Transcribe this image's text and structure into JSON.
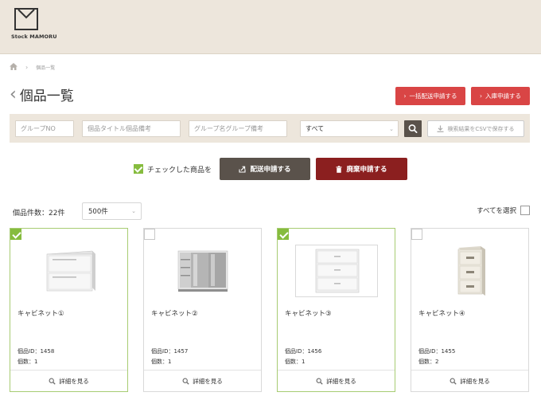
{
  "header": {
    "logo_text": "Stock MAMORU"
  },
  "breadcrumb": {
    "current": "個品一覧"
  },
  "page": {
    "title": "個品一覧"
  },
  "top_buttons": {
    "bulk_ship": "一括配送申請する",
    "warehouse": "入庫申請する"
  },
  "filter": {
    "group_no_placeholder": "グループNO",
    "title_placeholder": "個品タイトル個品備考",
    "group_name_placeholder": "グループ名グループ備考",
    "select_value": "すべて",
    "csv_label": "検索結果をCSVで保存する"
  },
  "actions": {
    "checked_label": "チェックした商品を",
    "ship_label": "配送申請する",
    "dispose_label": "廃棄申請する"
  },
  "list": {
    "count_label": "個品件数：22件",
    "per_page": "500件",
    "select_all": "すべてを選択"
  },
  "items": [
    {
      "name": "キャビネット①",
      "id_label": "個品ID：1458",
      "qty_label": "個数：1",
      "detail_label": "詳細を見る",
      "checked": true
    },
    {
      "name": "キャビネット②",
      "id_label": "個品ID：1457",
      "qty_label": "個数：1",
      "detail_label": "詳細を見る",
      "checked": false
    },
    {
      "name": "キャビネット③",
      "id_label": "個品ID：1456",
      "qty_label": "個数：1",
      "detail_label": "詳細を見る",
      "checked": true
    },
    {
      "name": "キャビネット④",
      "id_label": "個品ID：1455",
      "qty_label": "個数：2",
      "detail_label": "詳細を見る",
      "checked": false
    }
  ],
  "colors": {
    "header_bg": "#ede6dc",
    "red": "#d94545",
    "dark_brown": "#5a524b",
    "maroon": "#8b1f1f",
    "green": "#86bc3e"
  },
  "icons": [
    "home-icon",
    "chevron-right-icon",
    "chevron-left-icon",
    "search-icon",
    "download-icon",
    "export-icon",
    "trash-icon",
    "chevron-down-icon",
    "magnifier-icon"
  ]
}
